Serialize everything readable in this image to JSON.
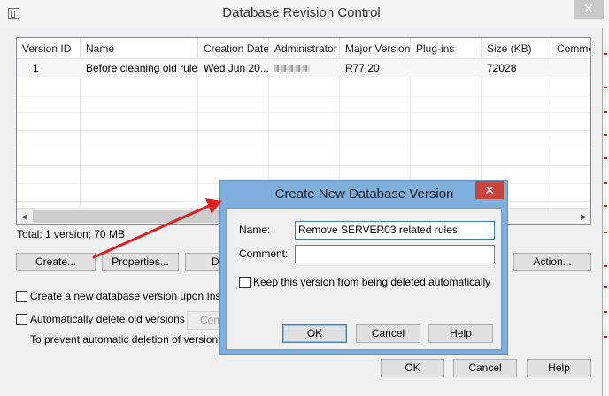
{
  "window": {
    "title": "Database Revision Control",
    "close_glyph": "✕"
  },
  "listview": {
    "columns": [
      "Version ID",
      "Name",
      "Creation Date",
      "Administrator",
      "Major Version",
      "Plug-ins",
      "Size (KB)",
      "Commen"
    ],
    "rows": [
      {
        "version_id": "1",
        "name": "Before cleaning old rules",
        "creation_date": "Wed Jun 20...",
        "administrator": "",
        "major_version": "R77.20",
        "plugins": "",
        "size_kb": "72028",
        "comment": ""
      }
    ]
  },
  "total": "Total: 1 version; 70 MB",
  "buttons": {
    "create": "Create...",
    "properties": "Properties...",
    "delete_partial": "D",
    "action": "Action...",
    "configure_partial": "Con",
    "ok": "OK",
    "cancel": "Cancel",
    "help": "Help"
  },
  "options": {
    "create_on_install": "Create a new database version upon Install P",
    "auto_delete": "Automatically delete old versions",
    "prevent_text": "To prevent automatic deletion of version, sele"
  },
  "dialog": {
    "title": "Create New Database Version",
    "close_glyph": "✕",
    "name_label": "Name:",
    "name_value": "Remove SERVER03 related rules",
    "comment_label": "Comment:",
    "comment_value": "",
    "keep_label": "Keep this version from being deleted automatically",
    "ok": "OK",
    "cancel": "Cancel",
    "help": "Help"
  },
  "colors": {
    "accent": "#3c7fb1",
    "annotation_arrow": "#e02020"
  }
}
